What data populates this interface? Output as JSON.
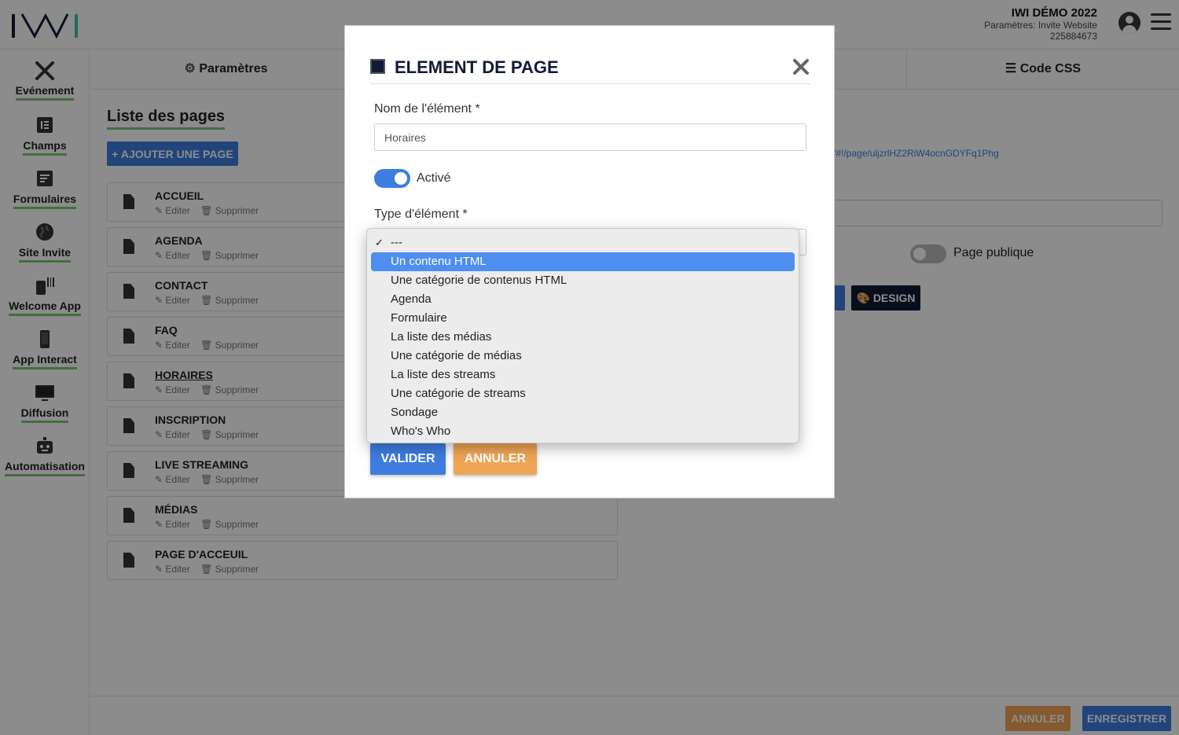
{
  "app": {
    "event_title": "IWI DÉMO 2022",
    "event_subtitle": "Paramètres: Invite Website",
    "event_id": "225884673"
  },
  "sidebar": {
    "items": [
      {
        "label": "Evénement",
        "icon": "tools-icon"
      },
      {
        "label": "Champs",
        "icon": "form-fields-icon"
      },
      {
        "label": "Formulaires",
        "icon": "forms-icon"
      },
      {
        "label": "Site Invite",
        "icon": "globe-icon"
      },
      {
        "label": "Welcome App",
        "icon": "mobile-qr-icon"
      },
      {
        "label": "App Interact",
        "icon": "mobile-icon"
      },
      {
        "label": "Diffusion",
        "icon": "monitor-icon"
      },
      {
        "label": "Automatisation",
        "icon": "robot-icon"
      }
    ]
  },
  "tabs": {
    "settings": "Paramètres",
    "css": "Code CSS"
  },
  "pages": {
    "title": "Liste des pages",
    "add_label": "+ AJOUTER UNE PAGE",
    "edit_label": "Editer",
    "delete_label": "Supprimer",
    "items": [
      {
        "name": "ACCUEIL"
      },
      {
        "name": "AGENDA"
      },
      {
        "name": "CONTACT"
      },
      {
        "name": "FAQ"
      },
      {
        "name": "HORAIRES"
      },
      {
        "name": "INSCRIPTION"
      },
      {
        "name": "LIVE STREAMING"
      },
      {
        "name": "MÉDIAS"
      },
      {
        "name": "PAGE D'ACCEUIL"
      }
    ]
  },
  "page_detail": {
    "url": "/#!/page/uljzrlHZ2RiW4ocnGDYFq1Phg",
    "public_label": "Page publique",
    "design_label": "DESIGN"
  },
  "footer": {
    "cancel": "ANNULER",
    "save": "ENREGISTRER"
  },
  "modal": {
    "title": "ELEMENT DE PAGE",
    "name_label": "Nom de l'élément *",
    "name_value": "Horaires",
    "active_label": "Activé",
    "type_label": "Type d'élément *",
    "validate": "VALIDER",
    "cancel": "ANNULER"
  },
  "dropdown": {
    "checked_mark": "✓",
    "options": [
      "---",
      "Un contenu HTML",
      "Une catégorie de contenus HTML",
      "Agenda",
      "Formulaire",
      "La liste des médias",
      "Une catégorie de médias",
      "La liste des streams",
      "Une catégorie de streams",
      "Sondage",
      "Who's Who"
    ],
    "checked_index": 0,
    "highlighted_index": 1
  },
  "colors": {
    "primary": "#3d7de0",
    "warning": "#f0a555",
    "navy": "#111a3a",
    "accent_green": "#7cc576"
  }
}
